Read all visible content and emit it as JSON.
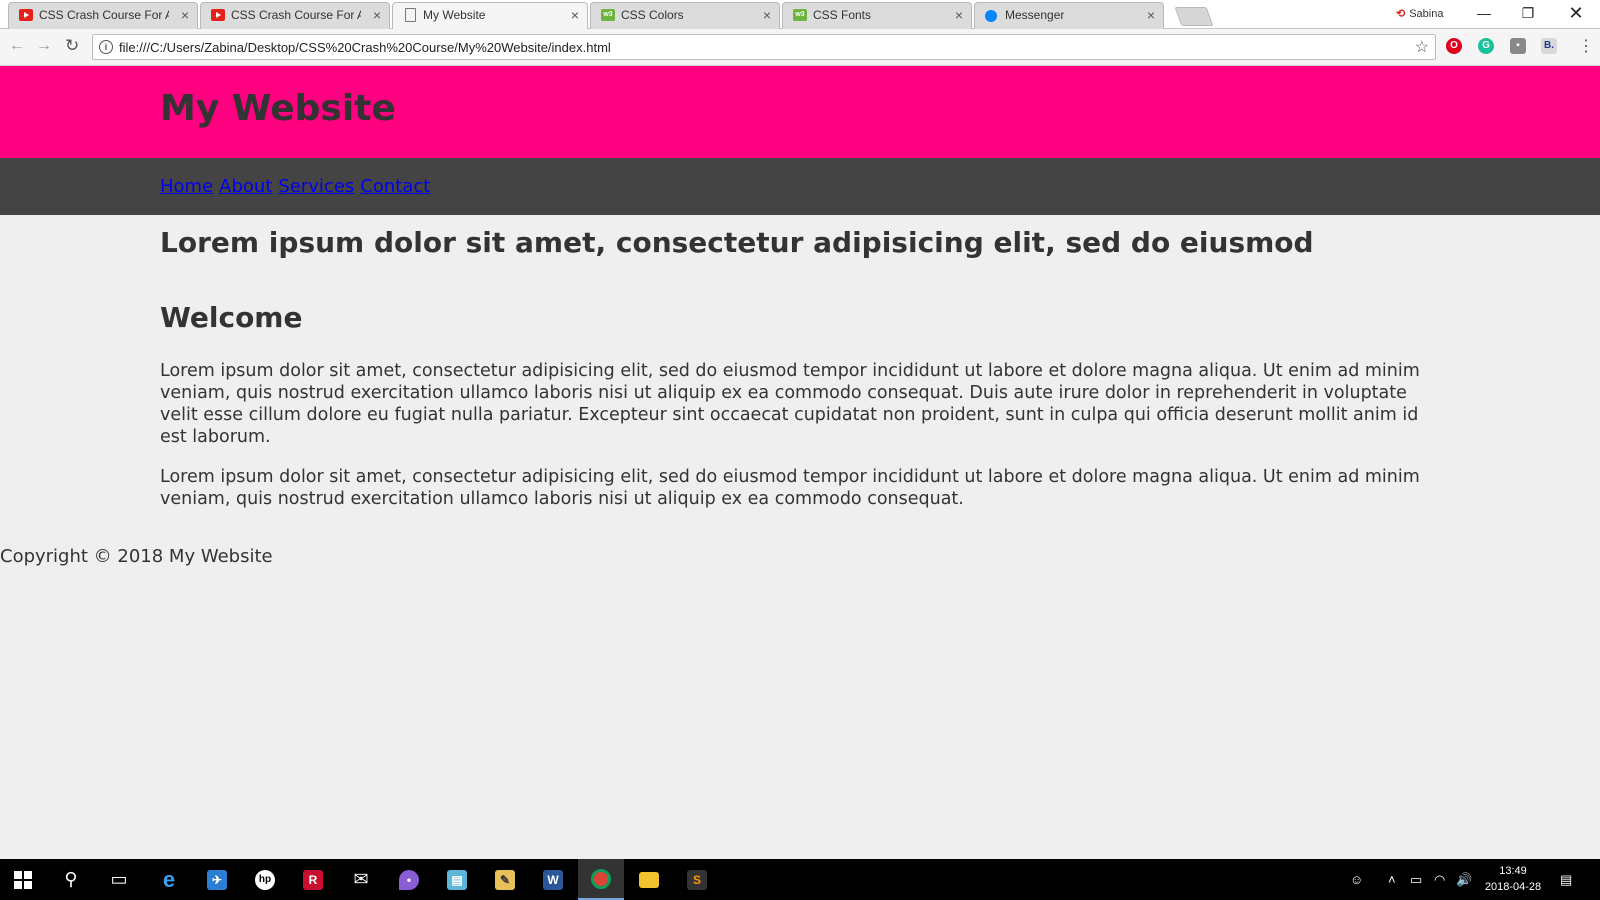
{
  "browser": {
    "tabs": [
      {
        "title": "CSS Crash Course For Ab",
        "favicon": "youtube-icon",
        "active": false
      },
      {
        "title": "CSS Crash Course For Ab",
        "favicon": "youtube-icon",
        "active": false
      },
      {
        "title": "My Website",
        "favicon": "document-icon",
        "active": true
      },
      {
        "title": "CSS Colors",
        "favicon": "w3schools-icon",
        "active": false
      },
      {
        "title": "CSS Fonts",
        "favicon": "w3schools-icon",
        "active": false
      },
      {
        "title": "Messenger",
        "favicon": "messenger-icon",
        "active": false
      }
    ],
    "profile_name": "Sabina",
    "url": "file:///C:/Users/Zabina/Desktop/CSS%20Crash%20Course/My%20Website/index.html"
  },
  "site": {
    "title": "My Website",
    "nav": [
      "Home",
      "About",
      "Services",
      "Contact"
    ],
    "headline": "Lorem ipsum dolor sit amet, consectetur adipisicing elit, sed do eiusmod",
    "welcome_heading": "Welcome",
    "paragraphs": [
      "Lorem ipsum dolor sit amet, consectetur adipisicing elit, sed do eiusmod tempor incididunt ut labore et dolore magna aliqua. Ut enim ad minim veniam, quis nostrud exercitation ullamco laboris nisi ut aliquip ex ea commodo consequat. Duis aute irure dolor in reprehenderit in voluptate velit esse cillum dolore eu fugiat nulla pariatur. Excepteur sint occaecat cupidatat non proident, sunt in culpa qui officia deserunt mollit anim id est laborum.",
      "Lorem ipsum dolor sit amet, consectetur adipisicing elit, sed do eiusmod tempor incididunt ut labore et dolore magna aliqua. Ut enim ad minim veniam, quis nostrud exercitation ullamco laboris nisi ut aliquip ex ea commodo consequat."
    ],
    "footer": "Copyright © 2018 My Website"
  },
  "colors": {
    "header_bg": "#ff0080",
    "nav_bg": "#444444",
    "page_bg": "#efefef",
    "link": "#0000ee"
  },
  "taskbar": {
    "time": "13:49",
    "date": "2018-04-28"
  }
}
